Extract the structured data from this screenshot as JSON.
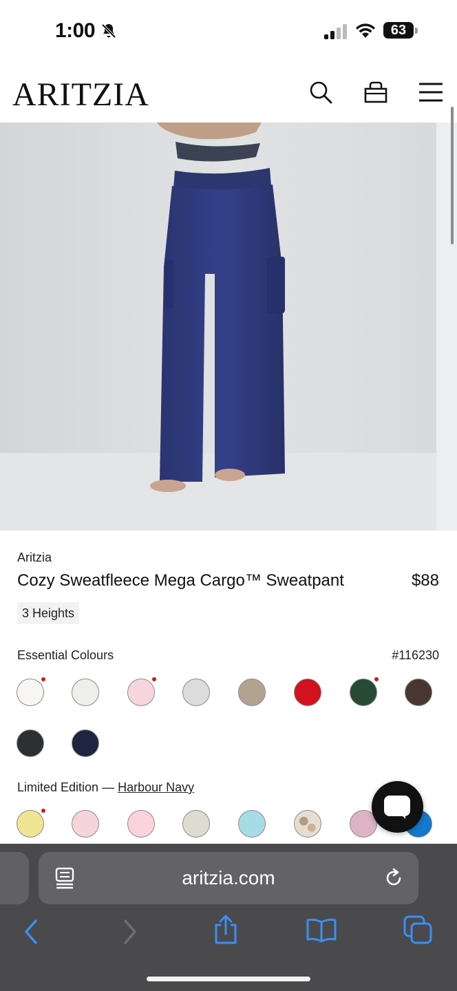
{
  "status": {
    "time": "1:00",
    "battery": "63"
  },
  "header": {
    "logo": "ARITZIA"
  },
  "product": {
    "brand": "Aritzia",
    "title": "Cozy Sweatfleece Mega Cargo™ Sweatpant",
    "price": "$88",
    "tag": "3 Heights"
  },
  "colours": {
    "essential_title": "Essential Colours",
    "style_code": "#116230",
    "essential": [
      {
        "name": "white-swatch",
        "color": "#f7f6f3",
        "dot": true
      },
      {
        "name": "heather-white-swatch",
        "color": "#eeeeea",
        "dot": false
      },
      {
        "name": "light-pink-swatch",
        "color": "#f6d6dc",
        "dot": true
      },
      {
        "name": "light-grey-swatch",
        "color": "#dcdcdc",
        "dot": false
      },
      {
        "name": "taupe-swatch",
        "color": "#b2a391",
        "dot": false
      },
      {
        "name": "red-swatch",
        "color": "#d2121e",
        "dot": false
      },
      {
        "name": "forest-green-swatch",
        "color": "#264a34",
        "dot": true
      },
      {
        "name": "brown-swatch",
        "color": "#4a3630",
        "dot": false
      },
      {
        "name": "black-swatch",
        "color": "#2e2f31",
        "dot": false
      },
      {
        "name": "navy-swatch",
        "color": "#1d2540",
        "dot": false
      }
    ],
    "limited_prefix": "Limited Edition — ",
    "limited_selected": "Harbour Navy",
    "limited": [
      {
        "name": "butter-yellow-swatch",
        "color": "#efe593",
        "dot": true
      },
      {
        "name": "blush-pink-swatch",
        "color": "#f6d4dc",
        "dot": false
      },
      {
        "name": "bubblegum-pink-swatch",
        "color": "#fbd2de",
        "dot": false
      },
      {
        "name": "oatmeal-swatch",
        "color": "#dedbd0",
        "dot": false
      },
      {
        "name": "sky-blue-swatch",
        "color": "#a7dbe6",
        "dot": false
      },
      {
        "name": "camo-print-swatch",
        "color": "#d8cbbd",
        "dot": false
      },
      {
        "name": "dusty-rose-swatch",
        "color": "#deb3c4",
        "dot": false
      },
      {
        "name": "bright-blue-swatch",
        "color": "#1479cf",
        "dot": false
      }
    ]
  },
  "browser": {
    "url": "aritzia.com"
  },
  "colors": {
    "accent": "#3b8ff6",
    "safari_bar": "#4a4a4c"
  }
}
